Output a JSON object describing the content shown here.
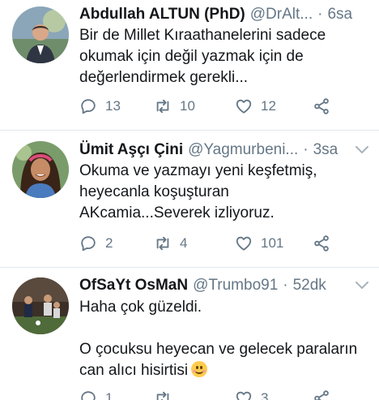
{
  "tweets": [
    {
      "name": "Abdullah ALTUN (PhD)",
      "handle": "@DrAlt...",
      "time": "6sa",
      "text": "Bir de Millet Kıraathanelerini sadece\nokumak için değil yazmak için de\ndeğerlendirmek gerekli...",
      "replies": "13",
      "retweets": "10",
      "likes": "12"
    },
    {
      "name": "Ümit Aşçı Çini",
      "handle": "@Yagmurbeni...",
      "time": "3sa",
      "text": "Okuma ve yazmayı yeni keşfetmiş,\nheyecanla koşuşturan\nAKcamia...Severek izliyoruz.",
      "replies": "2",
      "retweets": "4",
      "likes": "101"
    },
    {
      "name": "OfSaYt OsMaN",
      "handle": "@Trumbo91",
      "time": "52dk",
      "text_line1": "Haha çok güzeldi.",
      "text_line2": "O çocuksu heyecan ve gelecek paraların",
      "text_line3": "can alıcı hisirtisi",
      "replies": "1",
      "retweets": "",
      "likes": "3"
    }
  ],
  "separator": "·",
  "icons": {
    "reply": "reply-icon",
    "retweet": "retweet-icon",
    "like": "heart-icon",
    "share": "share-icon",
    "caret": "chevron-down-icon"
  },
  "colors": {
    "text": "#14171a",
    "muted": "#657786",
    "divider": "#e1e8ed"
  }
}
